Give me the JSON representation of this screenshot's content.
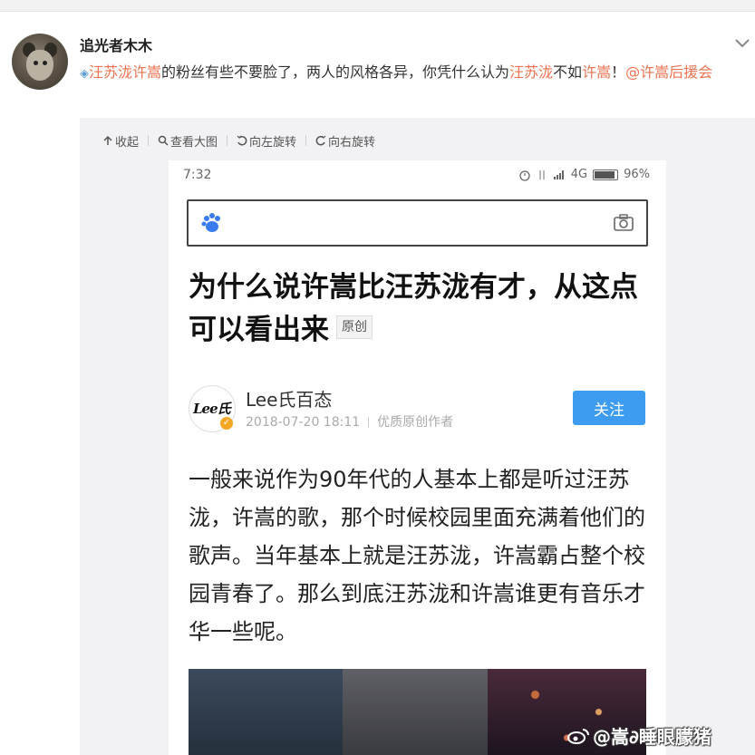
{
  "post": {
    "username": "追光者木木",
    "text": {
      "link1": "汪苏泷许嵩",
      "part1": "的粉丝有些不要脸了，两人的风格各异，你凭什么认为",
      "link2": "汪苏泷",
      "part2": "不如",
      "link3": "许嵩",
      "part3": "！",
      "mention": "@许嵩后援会"
    },
    "icons": {
      "topic": "diamond-icon",
      "menu": "chevron-down-icon"
    }
  },
  "toolbar": {
    "collapse": "收起",
    "view_large": "查看大图",
    "rotate_left": "向左旋转",
    "rotate_right": "向右旋转"
  },
  "phone": {
    "time": "7:32",
    "network": "4G",
    "battery": "96%",
    "title": "为什么说许嵩比汪苏泷有才，从这点可以看出来",
    "badge": "原创",
    "author": {
      "logo": "Lee氏",
      "name": "Lee氏百态",
      "date": "2018-07-20 18:11",
      "tag": "优质原创作者",
      "follow": "关注"
    },
    "body": "一般来说作为90年代的人基本上都是听过汪苏泷，许嵩的歌，那个时候校园里面充满着他们的歌声。当年基本上就是汪苏泷，许嵩霸占整个校园青春了。那么到底汪苏泷和许嵩谁更有音乐才华一些呢。"
  },
  "watermark": "@嵩∂睡眼朦猪",
  "colors": {
    "link": "#eb7350",
    "follow_button": "#3d9cf0",
    "panel": "#f2f2f5"
  }
}
